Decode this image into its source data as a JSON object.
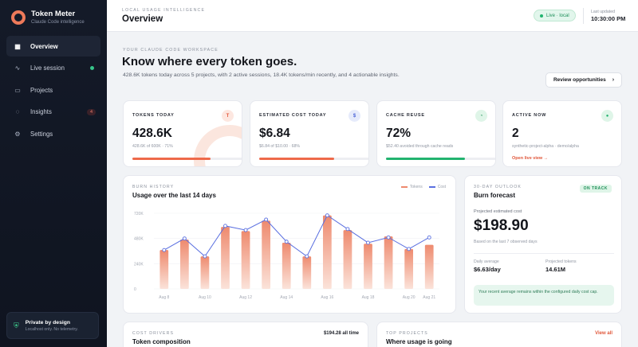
{
  "brand": {
    "name": "Token Meter",
    "subtitle": "Claude Code intelligence"
  },
  "nav": [
    {
      "label": "Overview",
      "icon": "grid-icon",
      "glyph": "▦",
      "active": true
    },
    {
      "label": "Live session",
      "icon": "pulse-icon",
      "glyph": "∿",
      "dot": true
    },
    {
      "label": "Projects",
      "icon": "folder-icon",
      "glyph": "▭"
    },
    {
      "label": "Insights",
      "icon": "lightbulb-icon",
      "glyph": "◌",
      "badge": "4"
    },
    {
      "label": "Settings",
      "icon": "gear-icon",
      "glyph": "⚙"
    }
  ],
  "privacy": {
    "title": "Private by design",
    "subtitle": "Localhost only. No telemetry."
  },
  "header": {
    "crumb": "LOCAL USAGE INTELLIGENCE",
    "title": "Overview",
    "live": "Live · local",
    "updated_label": "Last updated",
    "updated_time": "10:30:00 PM"
  },
  "hero": {
    "kicker": "YOUR CLAUDE CODE WORKSPACE",
    "title": "Know where every token goes.",
    "description": "428.6K tokens today across 5 projects, with 2 active sessions, 18.4K tokens/min recently, and 4 actionable insights.",
    "cta": "Review opportunities"
  },
  "kpis": [
    {
      "label": "TOKENS TODAY",
      "value": "428.6K",
      "sub": "428.6K of 600K · 71%",
      "progress": 0.71,
      "color": "#ee6a4a",
      "badge": "T",
      "badge_bg": "#fde7e0",
      "badge_fg": "#e4573a"
    },
    {
      "label": "ESTIMATED COST TODAY",
      "value": "$6.84",
      "sub": "$6.84 of $10.00 · 68%",
      "progress": 0.68,
      "color": "#ee6a4a",
      "badge": "$",
      "badge_bg": "#e6ebfb",
      "badge_fg": "#4a63d8"
    },
    {
      "label": "CACHE REUSE",
      "value": "72%",
      "sub": "$52.40 avoided through cache reads",
      "progress": 0.72,
      "color": "#22b36f",
      "badge": "◔",
      "badge_bg": "#dff5e8",
      "badge_fg": "#1d8f57"
    },
    {
      "label": "ACTIVE NOW",
      "value": "2",
      "sub": "synthetic-project-alpha · demo/alpha",
      "link": "Open live view →",
      "badge": "●",
      "badge_bg": "#dff5e8",
      "badge_fg": "#22b36f"
    }
  ],
  "burn": {
    "kicker": "BURN HISTORY",
    "title": "Usage over the last 14 days",
    "legend_tokens": "Tokens",
    "legend_cost": "Cost",
    "bar_color": "#ee8a6e",
    "line_color": "#5a6fe0"
  },
  "chart_data": {
    "type": "bar",
    "y_ticks": [
      "720K",
      "480K",
      "240K",
      "0"
    ],
    "ylim": [
      0,
      720000
    ],
    "x_tick_labels": [
      "Aug 8",
      "Aug 10",
      "Aug 12",
      "Aug 14",
      "Aug 16",
      "Aug 18",
      "Aug 20",
      "Aug 21"
    ],
    "series": [
      {
        "name": "Tokens",
        "type": "bar",
        "values": [
          370000,
          470000,
          310000,
          590000,
          550000,
          650000,
          440000,
          310000,
          700000,
          560000,
          430000,
          500000,
          380000,
          420000
        ]
      },
      {
        "name": "Cost",
        "type": "line",
        "values": [
          370000,
          480000,
          310000,
          600000,
          560000,
          660000,
          450000,
          310000,
          700000,
          570000,
          440000,
          490000,
          380000,
          490000
        ]
      }
    ]
  },
  "forecast": {
    "kicker": "30-DAY OUTLOOK",
    "title": "Burn forecast",
    "status": "ON TRACK",
    "label": "Projected estimated cost",
    "value": "$198.90",
    "sub": "Based on the last 7 observed days",
    "daily_label": "Daily average",
    "daily_value": "$6.63/day",
    "tokens_label": "Projected tokens",
    "tokens_value": "14.61M",
    "note": "Your recent average remains within the configured daily cost cap."
  },
  "cost_drivers": {
    "kicker": "COST DRIVERS",
    "title": "Token composition",
    "total": "$194.28 all time"
  },
  "top_projects": {
    "kicker": "TOP PROJECTS",
    "title": "Where usage is going",
    "link": "View all"
  }
}
